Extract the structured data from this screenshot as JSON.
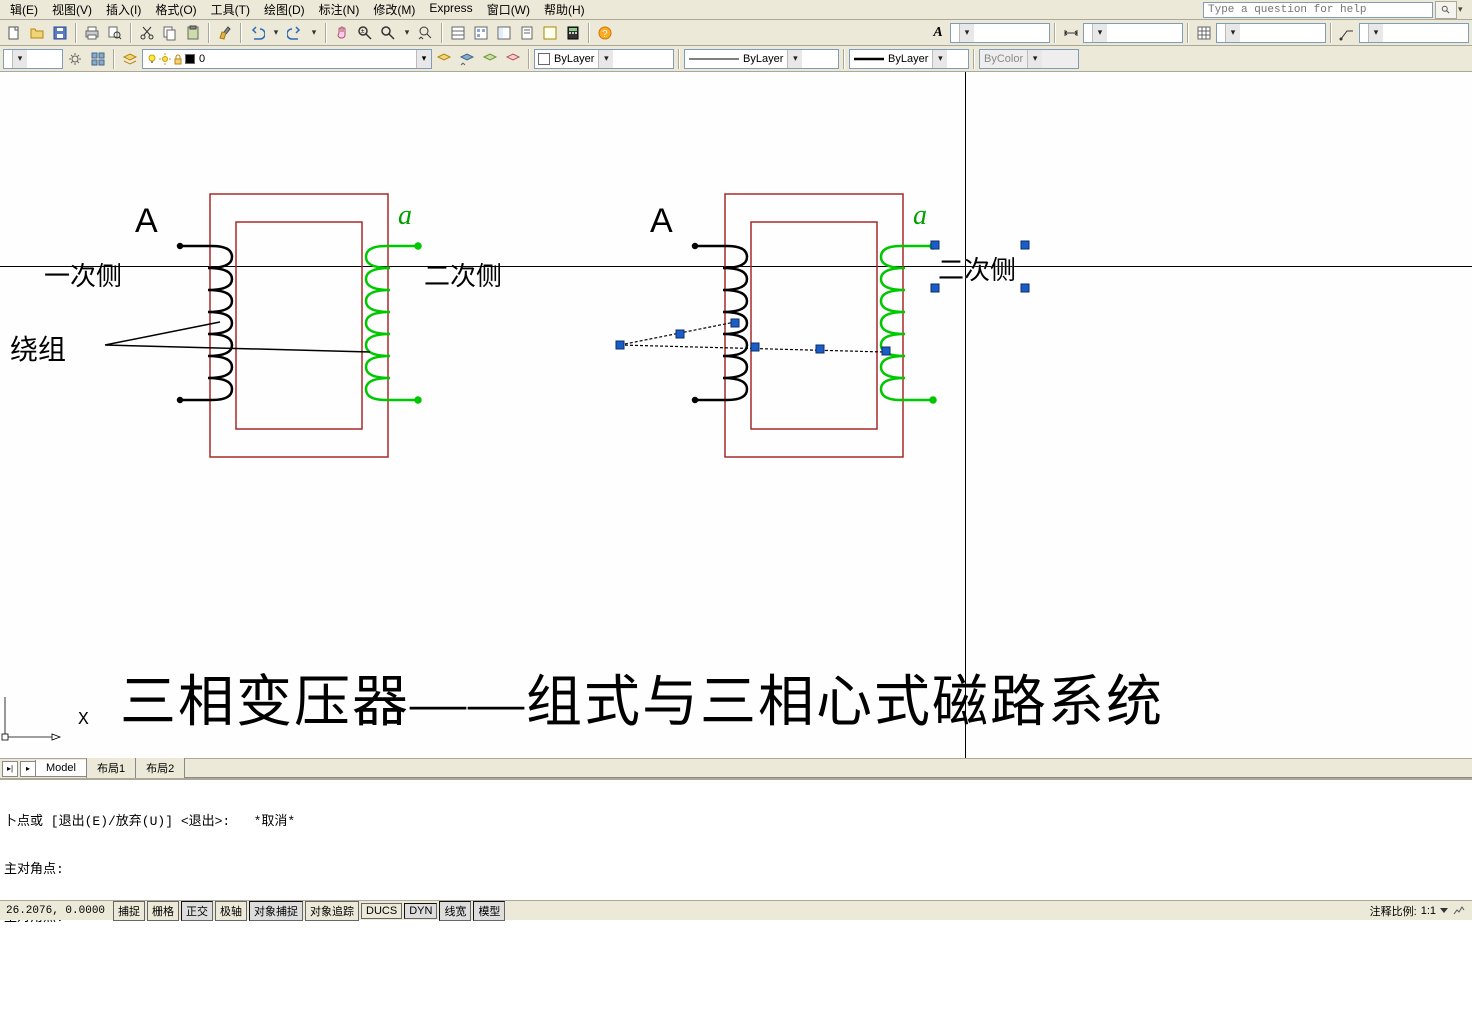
{
  "menubar": {
    "items": [
      "辑(E)",
      "视图(V)",
      "插入(I)",
      "格式(O)",
      "工具(T)",
      "绘图(D)",
      "标注(N)",
      "修改(M)",
      "Express",
      "窗口(W)",
      "帮助(H)"
    ],
    "help_placeholder": "Type a question for help"
  },
  "toolbar2": {
    "layer_name": "0",
    "color_label": "ByLayer",
    "linetype_label": "ByLayer",
    "lineweight_label": "ByLayer",
    "plotstyle_label": "ByColor"
  },
  "tabs": {
    "items": [
      "Model",
      "布局1",
      "布局2"
    ],
    "active": 0
  },
  "command": {
    "lines": [
      "卜点或 [退出(E)/放弃(U)] <退出>:   *取消*",
      "主对角点:",
      "主对角点:",
      "",
      ""
    ]
  },
  "status": {
    "coords": "26.2076, 0.0000",
    "toggles": [
      "捕捉",
      "栅格",
      "正交",
      "极轴",
      "对象捕捉",
      "对象追踪",
      "DUCS",
      "DYN",
      "线宽",
      "模型"
    ],
    "annotation_scale_label": "注释比例:",
    "annotation_scale_value": "1:1"
  },
  "drawing": {
    "label_primary": "一次侧",
    "label_secondary": "二次侧",
    "label_winding": "绕组",
    "label_A": "A",
    "label_a": "a",
    "title": "三相变压器——组式与三相心式磁路系统",
    "axis_x": "X"
  }
}
